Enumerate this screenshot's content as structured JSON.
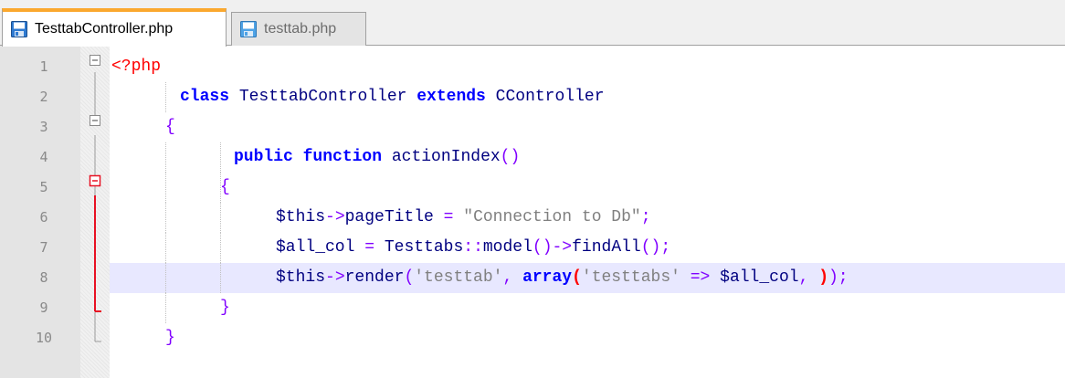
{
  "tabs": [
    {
      "label": "TesttabController.php",
      "active": true
    },
    {
      "label": "testtab.php",
      "active": false
    }
  ],
  "colors": {
    "active_tab_accent": "#fba82e",
    "current_line": "#e8e8ff",
    "fold_highlight": "#e81123"
  },
  "lines": [
    {
      "number": "1",
      "tokens": [
        {
          "t": "<?php",
          "c": "phptag"
        }
      ]
    },
    {
      "number": "2",
      "tokens": [
        {
          "t": "class",
          "c": "kw"
        },
        {
          "t": " TesttabController ",
          "c": "txt"
        },
        {
          "t": "extends",
          "c": "kw"
        },
        {
          "t": " CController",
          "c": "txt"
        }
      ]
    },
    {
      "number": "3",
      "tokens": [
        {
          "t": "{",
          "c": "brace"
        }
      ]
    },
    {
      "number": "4",
      "tokens": [
        {
          "t": "public",
          "c": "kw"
        },
        {
          "t": " ",
          "c": "txt"
        },
        {
          "t": "function",
          "c": "kw"
        },
        {
          "t": " actionIndex",
          "c": "txt"
        },
        {
          "t": "()",
          "c": "op"
        }
      ]
    },
    {
      "number": "5",
      "tokens": [
        {
          "t": "{",
          "c": "brace"
        }
      ]
    },
    {
      "number": "6",
      "tokens": [
        {
          "t": "$this",
          "c": "var"
        },
        {
          "t": "->",
          "c": "op"
        },
        {
          "t": "pageTitle ",
          "c": "txt"
        },
        {
          "t": "=",
          "c": "op"
        },
        {
          "t": " ",
          "c": "txt"
        },
        {
          "t": "\"Connection to Db\"",
          "c": "str"
        },
        {
          "t": ";",
          "c": "op"
        }
      ]
    },
    {
      "number": "7",
      "tokens": [
        {
          "t": "$all_col",
          "c": "var"
        },
        {
          "t": " ",
          "c": "txt"
        },
        {
          "t": "=",
          "c": "op"
        },
        {
          "t": " Testtabs",
          "c": "txt"
        },
        {
          "t": "::",
          "c": "op"
        },
        {
          "t": "model",
          "c": "txt"
        },
        {
          "t": "()->",
          "c": "op"
        },
        {
          "t": "findAll",
          "c": "txt"
        },
        {
          "t": "();",
          "c": "op"
        }
      ]
    },
    {
      "number": "8",
      "tokens": [
        {
          "t": "$this",
          "c": "var"
        },
        {
          "t": "->",
          "c": "op"
        },
        {
          "t": "render",
          "c": "txt"
        },
        {
          "t": "(",
          "c": "op"
        },
        {
          "t": "'testtab'",
          "c": "str"
        },
        {
          "t": ", ",
          "c": "op"
        },
        {
          "t": "array",
          "c": "arr"
        },
        {
          "t": "(",
          "c": "paren-hl"
        },
        {
          "t": "'testtabs'",
          "c": "str"
        },
        {
          "t": " => ",
          "c": "op"
        },
        {
          "t": "$all_col",
          "c": "var"
        },
        {
          "t": ", ",
          "c": "op"
        },
        {
          "t": ")",
          "c": "paren-hl"
        },
        {
          "t": ");",
          "c": "op"
        }
      ]
    },
    {
      "number": "9",
      "tokens": [
        {
          "t": "}",
          "c": "brace"
        }
      ]
    },
    {
      "number": "10",
      "tokens": [
        {
          "t": "}",
          "c": "brace"
        }
      ]
    }
  ]
}
